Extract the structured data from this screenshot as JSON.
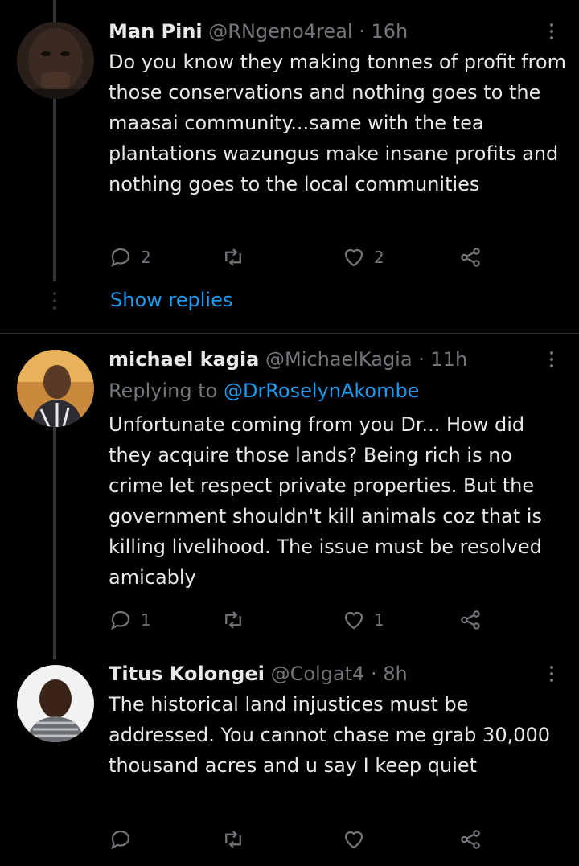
{
  "tweets": [
    {
      "name": "Man Pini",
      "handle": "@RNgeno4real",
      "time": "16h",
      "text": "Do you know they making tonnes of profit from those conservations and nothing goes to the maasai community...same with the tea plantations wazungus make insane profits and nothing goes to the local communities",
      "replies": "2",
      "retweets": "",
      "likes": "2"
    },
    {
      "name": "michael kagia",
      "handle": "@MichaelKagia",
      "time": "11h",
      "replying_prefix": "Replying to ",
      "replying_to": "@DrRoselynAkombe",
      "text": "Unfortunate coming from you Dr... How did they acquire those lands? Being rich is no crime let respect private properties. But the government shouldn't kill animals coz that is killing livelihood. The issue must be resolved amicably",
      "replies": "1",
      "retweets": "",
      "likes": "1"
    },
    {
      "name": "Titus Kolongei",
      "handle": "@Colgat4",
      "time": "8h",
      "text": "The historical land injustices must be addressed. You cannot chase me grab 30,000 thousand acres and u say I keep quiet",
      "replies": "",
      "retweets": "",
      "likes": ""
    }
  ],
  "show_replies_label": "Show replies",
  "separator": "·",
  "colors": {
    "background": "#000000",
    "text": "#e7e9ea",
    "muted": "#71767b",
    "link": "#1d9bf0",
    "line": "#333639"
  },
  "icons": [
    "reply-icon",
    "retweet-icon",
    "like-icon",
    "share-icon",
    "more-icon"
  ]
}
